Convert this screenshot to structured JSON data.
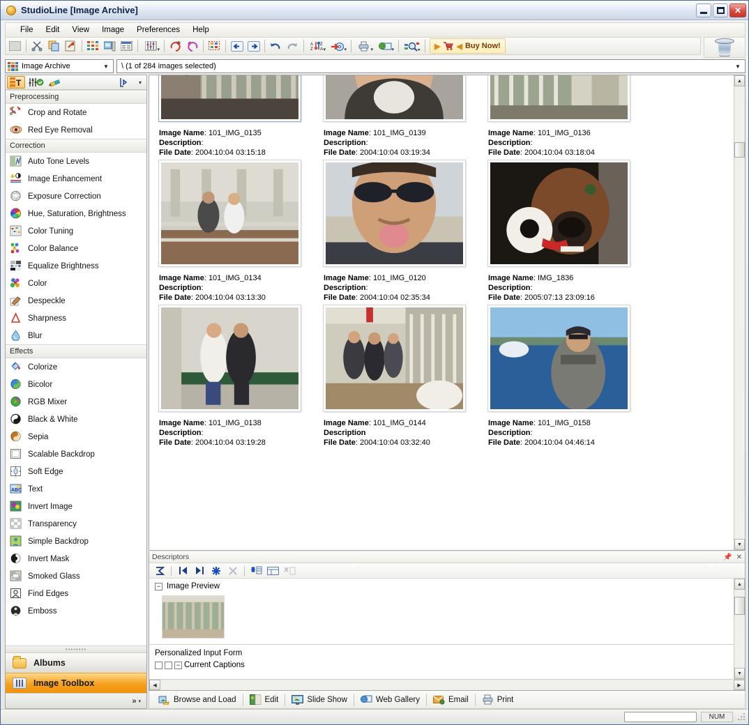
{
  "window": {
    "title": "StudioLine [Image Archive]",
    "app_icon": "sun-icon",
    "buttons": {
      "minimize": "minimize-button",
      "maximize": "maximize-button",
      "close": "close-button"
    }
  },
  "menubar": {
    "items": [
      "File",
      "Edit",
      "View",
      "Image",
      "Preferences",
      "Help"
    ]
  },
  "toolbar": {
    "groups": [
      [
        {
          "name": "blank-button",
          "glyph": ""
        }
      ],
      [
        {
          "name": "cut-icon",
          "glyph": "✂"
        },
        {
          "name": "copy-icon",
          "glyph": "⧉"
        },
        {
          "name": "paste-icon",
          "glyph": "📋"
        }
      ],
      [
        {
          "name": "thumbnail-view-icon",
          "glyph": "▦"
        },
        {
          "name": "details-view-icon",
          "glyph": "🖵"
        },
        {
          "name": "list-view-icon",
          "glyph": "▤"
        }
      ],
      [
        {
          "name": "adjust-levels-icon",
          "glyph": "⇅"
        }
      ],
      [
        {
          "name": "rotate-right-90-icon",
          "glyph": "↻"
        },
        {
          "name": "rotate-left-90-icon",
          "glyph": "↺"
        }
      ],
      [
        {
          "name": "select-all-icon",
          "glyph": "▩"
        }
      ],
      [
        {
          "name": "back-icon",
          "glyph": "←"
        },
        {
          "name": "forward-icon",
          "glyph": "→"
        }
      ],
      [
        {
          "name": "undo-icon",
          "glyph": "↩"
        },
        {
          "name": "redo-icon",
          "glyph": "↪"
        }
      ],
      [
        {
          "name": "sort-icon",
          "glyph": "A↕Z"
        },
        {
          "name": "burn-cd-icon",
          "glyph": "⊙"
        },
        {
          "name": "print-icon",
          "glyph": "🖶"
        },
        {
          "name": "web-gallery-icon",
          "glyph": "🌐"
        },
        {
          "name": "zoom-icon",
          "glyph": "🔍"
        }
      ]
    ],
    "buy_now": {
      "label": "Buy Now!",
      "left_arrow": "◀",
      "right_arrow": "▶",
      "cart_icon": "shopping-cart-icon"
    },
    "trash": "trash-can-icon"
  },
  "address": {
    "archive_selector": {
      "value": "Image Archive",
      "icon": "color-grid-icon"
    },
    "path": "\\ (1 of 284 images selected)"
  },
  "sidebar": {
    "tabs": [
      {
        "name": "descriptor-tab",
        "icon": "text-grid-icon",
        "active": true
      },
      {
        "name": "toolbox-tab",
        "icon": "sliders-check-icon",
        "active": false
      },
      {
        "name": "color-picker-tab",
        "icon": "eyedropper-icon",
        "active": false
      },
      {
        "name": "detach-tab",
        "icon": "detach-icon",
        "active": false
      }
    ],
    "groups": [
      {
        "heading": "Preprocessing",
        "tools": [
          {
            "label": "Crop and Rotate",
            "icon": "crop-rotate-icon"
          },
          {
            "label": "Red Eye Removal",
            "icon": "red-eye-icon"
          }
        ]
      },
      {
        "heading": "Correction",
        "tools": [
          {
            "label": "Auto Tone Levels",
            "icon": "auto-tone-icon"
          },
          {
            "label": "Image Enhancement",
            "icon": "enhancement-icon"
          },
          {
            "label": "Exposure Correction",
            "icon": "aperture-icon"
          },
          {
            "label": "Hue, Saturation, Brightness",
            "icon": "color-wheel-icon"
          },
          {
            "label": "Color Tuning",
            "icon": "color-tuning-icon"
          },
          {
            "label": "Color Balance",
            "icon": "color-balance-icon"
          },
          {
            "label": "Equalize Brightness",
            "icon": "equalize-icon"
          },
          {
            "label": "Color",
            "icon": "color-spheres-icon"
          },
          {
            "label": "Despeckle",
            "icon": "despeckle-icon"
          },
          {
            "label": "Sharpness",
            "icon": "sharpness-icon"
          },
          {
            "label": "Blur",
            "icon": "blur-drop-icon"
          }
        ]
      },
      {
        "heading": "Effects",
        "tools": [
          {
            "label": "Colorize",
            "icon": "paint-bucket-icon"
          },
          {
            "label": "Bicolor",
            "icon": "bicolor-icon"
          },
          {
            "label": "RGB Mixer",
            "icon": "rgb-spiral-icon"
          },
          {
            "label": "Black & White",
            "icon": "yin-yang-icon"
          },
          {
            "label": "Sepia",
            "icon": "sepia-icon"
          },
          {
            "label": "Scalable Backdrop",
            "icon": "scalable-backdrop-icon"
          },
          {
            "label": "Soft Edge",
            "icon": "soft-edge-icon"
          },
          {
            "label": "Text",
            "icon": "text-abc-icon"
          },
          {
            "label": "Invert Image",
            "icon": "invert-image-icon"
          },
          {
            "label": "Transparency",
            "icon": "checkerboard-icon"
          },
          {
            "label": "Simple Backdrop",
            "icon": "simple-backdrop-icon"
          },
          {
            "label": "Invert Mask",
            "icon": "invert-mask-icon"
          },
          {
            "label": "Smoked Glass",
            "icon": "smoked-glass-icon"
          },
          {
            "label": "Find Edges",
            "icon": "find-edges-icon"
          },
          {
            "label": "Emboss",
            "icon": "emboss-icon"
          }
        ]
      }
    ],
    "nav_buttons": [
      {
        "label": "Albums",
        "icon": "folder-icon",
        "active": false
      },
      {
        "label": "Image Toolbox",
        "icon": "toolbox-icon",
        "active": true
      }
    ],
    "more_icon": "chevron-double-right-icon"
  },
  "thumbnails": {
    "labels": {
      "name": "Image Name",
      "description": "Description",
      "file_date": "File Date"
    },
    "rows": [
      [
        {
          "name": "101_IMG_0135",
          "description": "",
          "file_date": "2004:10:04 03:15:18",
          "art": "jail-bars"
        },
        {
          "name": "101_IMG_0139",
          "description": "",
          "file_date": "2004:10:04 03:19:34",
          "art": "man-closeup"
        },
        {
          "name": "101_IMG_0136",
          "description": "",
          "file_date": "2004:10:04 03:18:04",
          "art": "cell-green"
        }
      ],
      [
        {
          "name": "101_IMG_0134",
          "description": "",
          "file_date": "2004:10:04 03:13:30",
          "art": "hall-people"
        },
        {
          "name": "101_IMG_0120",
          "description": "",
          "file_date": "2004:10:04 02:35:34",
          "art": "sunglasses-tongue"
        },
        {
          "name": "IMG_1836",
          "description": "",
          "file_date": "2005:07:13 23:09:16",
          "art": "dog-toy"
        }
      ],
      [
        {
          "name": "101_IMG_0138",
          "description": "",
          "file_date": "2004:10:04 03:19:28",
          "art": "two-women"
        },
        {
          "name": "101_IMG_0144",
          "description": "",
          "file_date": "2004:10:04 03:32:40",
          "art": "corridor-group"
        },
        {
          "name": "101_IMG_0158",
          "description": "",
          "file_date": "2004:10:04 04:46:14",
          "art": "man-boat"
        }
      ]
    ]
  },
  "descriptors": {
    "panel_title": "Descriptors",
    "pin_icon": "pin-icon",
    "close_icon": "close-icon",
    "toolbar": [
      {
        "name": "sigma-icon",
        "glyph": "⊼"
      },
      {
        "name": "first-icon",
        "glyph": "|◀"
      },
      {
        "name": "last-icon",
        "glyph": "▶|"
      },
      {
        "name": "new-descriptor-icon",
        "glyph": "✳"
      },
      {
        "name": "delete-descriptor-icon",
        "glyph": "✖"
      },
      {
        "name": "add-field-icon",
        "glyph": "✳▤"
      },
      {
        "name": "edit-field-icon",
        "glyph": "▤▤"
      },
      {
        "name": "remove-field-icon",
        "glyph": "✖▤"
      }
    ],
    "sections": [
      {
        "label": "Image Preview",
        "expanded": true
      },
      {
        "label": "Personalized Input Form",
        "expanded": true
      },
      {
        "label": "Current Captions",
        "expanded": true
      }
    ]
  },
  "action_bar": {
    "items": [
      {
        "label": "Browse and Load",
        "icon": "browse-load-icon"
      },
      {
        "label": "Edit",
        "icon": "edit-icon"
      },
      {
        "label": "Slide Show",
        "icon": "slide-show-icon"
      },
      {
        "label": "Web Gallery",
        "icon": "web-gallery-icon"
      },
      {
        "label": "Email",
        "icon": "email-icon"
      },
      {
        "label": "Print",
        "icon": "print-icon"
      }
    ]
  },
  "statusbar": {
    "field_value": "",
    "num_lock": "NUM"
  },
  "colors": {
    "accent_orange": "#f5a01c",
    "title_blue": "#10244a",
    "close_red": "#c0392b",
    "toolbar_bg": "#ececE6"
  }
}
